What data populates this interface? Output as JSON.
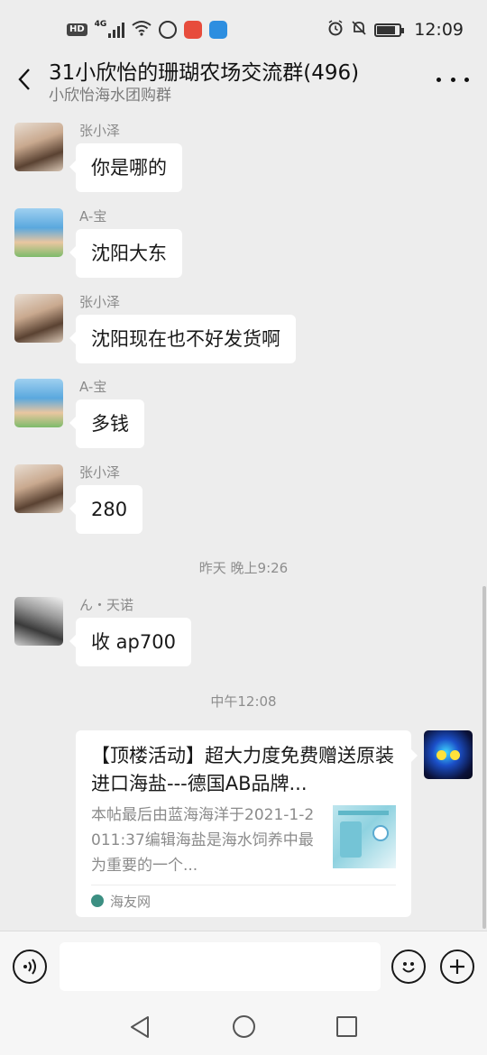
{
  "status_bar": {
    "hd": "HD",
    "network": "4G",
    "time": "12:09"
  },
  "header": {
    "title": "31小欣怡的珊瑚农场交流群(496)",
    "subtitle": "小欣怡海水团购群"
  },
  "messages": [
    {
      "sender": "张小泽",
      "text": "你是哪的"
    },
    {
      "sender": "A-宝",
      "text": "沈阳大东"
    },
    {
      "sender": "张小泽",
      "text": "沈阳现在也不好发货啊"
    },
    {
      "sender": "A-宝",
      "text": "多钱"
    },
    {
      "sender": "张小泽",
      "text": "280"
    },
    {
      "sender": "ん・天诺",
      "text": "收 ap700"
    }
  ],
  "timestamps": [
    "昨天 晚上9:26",
    "中午12:08"
  ],
  "link_card": {
    "title": "【顶楼活动】超大力度免费赠送原装进口海盐---德国AB品牌...",
    "description": "本帖最后由蓝海海洋于2021-1-2011:37编辑海盐是海水饲养中最为重要的一个...",
    "source": "海友网"
  },
  "input": {
    "placeholder": ""
  },
  "icons": {
    "back": "chevron-left-icon",
    "more": "more-dots-icon",
    "voice": "voice-icon",
    "emoji": "emoji-icon",
    "plus": "plus-icon"
  }
}
